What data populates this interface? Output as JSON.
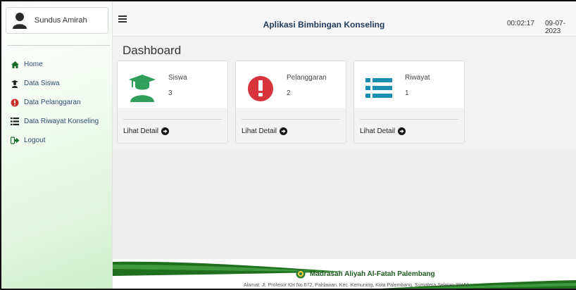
{
  "sidebar": {
    "user_name": "Sundus Amirah",
    "items": [
      {
        "label": "Home",
        "icon": "home-icon"
      },
      {
        "label": "Data Siswa",
        "icon": "student-icon"
      },
      {
        "label": "Data Pelanggaran",
        "icon": "alert-icon"
      },
      {
        "label": "Data Riwayat Konseling",
        "icon": "list-icon"
      },
      {
        "label": "Logout",
        "icon": "logout-icon"
      }
    ]
  },
  "header": {
    "title": "Aplikasi Bimbingan Konseling",
    "time": "00:02:17",
    "date": "09-07-2023"
  },
  "main": {
    "page_title": "Dashboard",
    "cards": [
      {
        "label": "Siswa",
        "value": "3",
        "link": "Lihat Detail",
        "icon": "graduate-icon",
        "color": "#2f9e5a"
      },
      {
        "label": "Pelanggaran",
        "value": "2",
        "link": "Lihat Detail",
        "icon": "exclamation-icon",
        "color": "#d8343b"
      },
      {
        "label": "Riwayat",
        "value": "1",
        "link": "Lihat Detail",
        "icon": "list-icon",
        "color": "#1b8fb3"
      }
    ]
  },
  "footer": {
    "school": "Madrasah Aliyah Al-Fatah Palembang",
    "address": "Alamat: Jl. Profesor KH No.672, Pahlawan, Kec. Kemuning, Kota Palembang, Sumatera Selatan 30151"
  },
  "colors": {
    "accent": "#1e7a1e",
    "nav_text": "#2d4f6e",
    "title": "#1e3a5a"
  }
}
